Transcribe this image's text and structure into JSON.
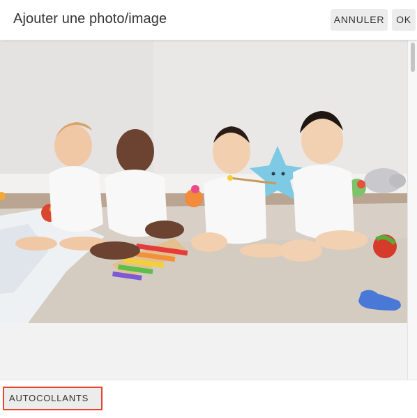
{
  "dialog": {
    "title": "Ajouter une photo/image",
    "cancel_label": "ANNULER",
    "ok_label": "OK"
  },
  "footer": {
    "stickers_label": "AUTOCOLLANTS"
  },
  "colors": {
    "highlight_border": "#e8432d",
    "button_bg": "#ececec",
    "text": "#333333"
  }
}
